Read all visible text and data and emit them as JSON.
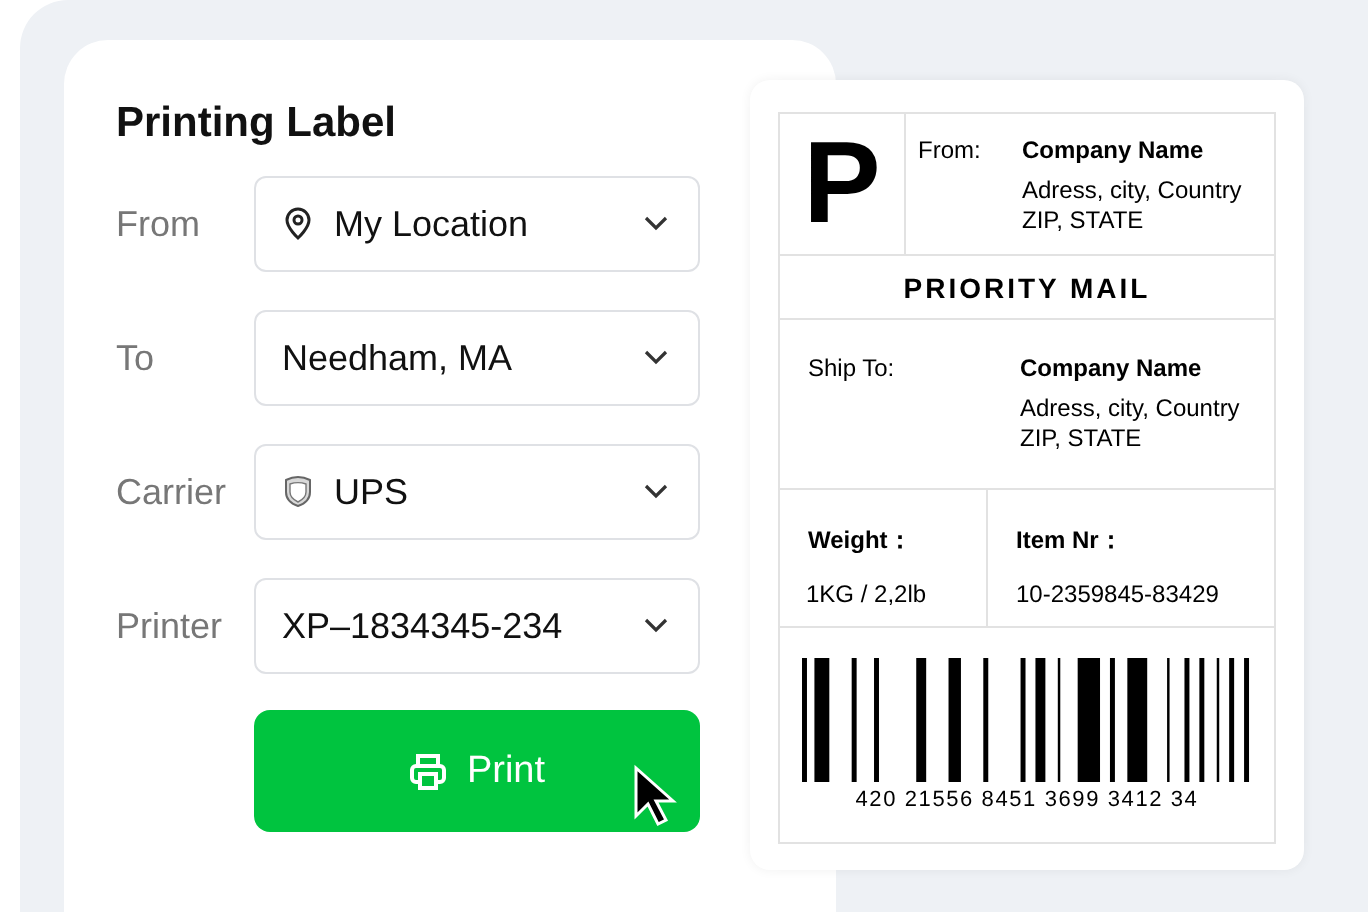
{
  "form": {
    "title": "Printing Label",
    "fields": [
      {
        "label": "From",
        "value": "My Location",
        "kind": "location"
      },
      {
        "label": "To",
        "value": "Needham, MA",
        "kind": "plain"
      },
      {
        "label": "Carrier",
        "value": "UPS",
        "kind": "carrier"
      },
      {
        "label": "Printer",
        "value": "XP–1834345-234",
        "kind": "plain"
      }
    ],
    "print_button": "Print"
  },
  "shipping_label": {
    "mark": "P",
    "from": {
      "label": "From:",
      "company": "Company Name",
      "address": "Adress, city, Country",
      "region": "ZIP, STATE"
    },
    "service": "PRIORITY MAIL",
    "ship_to": {
      "label": "Ship To:",
      "company": "Company Name",
      "address": "Adress, city, Country",
      "region": "ZIP, STATE"
    },
    "weight": {
      "label": "Weight：",
      "value": "1KG / 2,2lb"
    },
    "item": {
      "label": "Item Nr：",
      "value": "10-2359845-83429"
    },
    "barcode_number": "420 21556 8451 3699 3412 34"
  }
}
